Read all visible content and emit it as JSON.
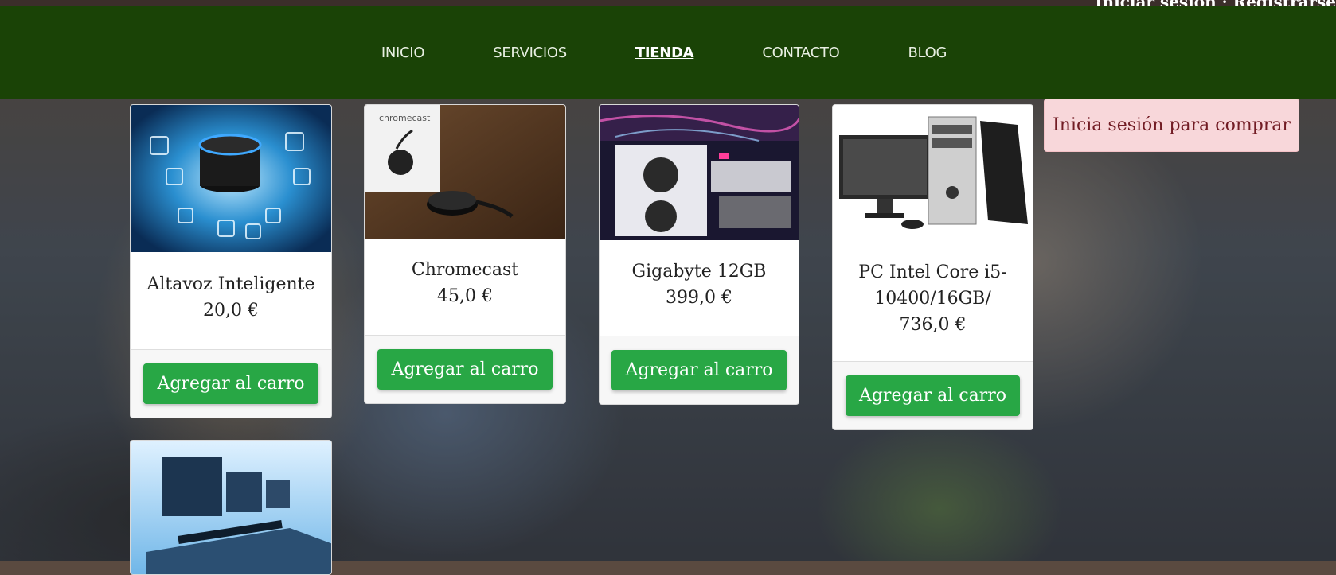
{
  "header": {
    "auth_text": "Iniciar sesión · Registrarse"
  },
  "nav": {
    "items": [
      {
        "label": "INICIO"
      },
      {
        "label": "SERVICIOS"
      },
      {
        "label": "TIENDA",
        "active": true
      },
      {
        "label": "CONTACTO"
      },
      {
        "label": "BLOG"
      }
    ]
  },
  "alert": {
    "text": "Inicia sesión para comprar"
  },
  "products": [
    {
      "name": "Altavoz Inteligente",
      "price": "20,0 €",
      "button": "Agregar al carro"
    },
    {
      "name": "Chromecast",
      "price": "45,0 €",
      "button": "Agregar al carro"
    },
    {
      "name": "Gigabyte 12GB",
      "price": "399,0 €",
      "button": "Agregar al carro"
    },
    {
      "name_line1": "PC Intel Core i5-",
      "name_line2": "10400/16GB/",
      "price": "736,0 €",
      "button": "Agregar al carro"
    }
  ],
  "colors": {
    "navbar": "#1a4306",
    "button": "#28a745",
    "alert_bg": "#f8d7da",
    "alert_text": "#721c24"
  }
}
